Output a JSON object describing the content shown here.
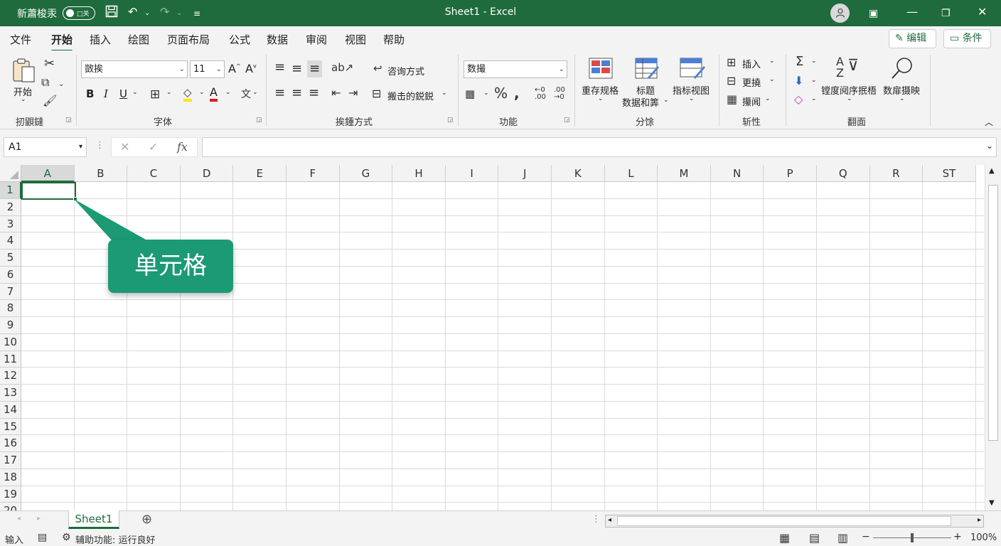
{
  "titlebar": {
    "autosave_label": "新蕭梭汞",
    "toggle_text": "□关",
    "window_title": "Sheet1  -  Excel"
  },
  "menu": {
    "tabs": [
      "文件",
      "开始",
      "插入",
      "绘图",
      "页面布局",
      "公式",
      "数据",
      "审阅",
      "视图",
      "帮助"
    ],
    "edit_button": "编辑",
    "comment_button": "条件"
  },
  "ribbon": {
    "clipboard": {
      "paste_label": "开始",
      "group_name": "扨鼰鐽"
    },
    "font": {
      "font_name": "敳挨",
      "font_size": "11",
      "group_name": "字体"
    },
    "alignment": {
      "wrap_label": "咨询方式",
      "merge_label": "搬击的鋭鋭",
      "group_name": "挨鍾方式"
    },
    "number": {
      "format": "数撮",
      "group_name": "功能"
    },
    "styles": {
      "cond_label": "重存规格",
      "table_label_1": "标题",
      "table_label_2": "数据和筭",
      "cell_label": "指标视图",
      "group_name": "分馀"
    },
    "cells": {
      "insert": "插入",
      "delete": "更撓",
      "format": "攥闻",
      "group_name": "斩性"
    },
    "editing": {
      "sort_label": "镗度阋序抿梧",
      "find_label": "数扉摄映",
      "group_name": "翻面"
    }
  },
  "formula_bar": {
    "name_box": "A1",
    "fx_label": "fx",
    "formula": ""
  },
  "grid": {
    "columns": [
      "A",
      "B",
      "C",
      "D",
      "E",
      "F",
      "G",
      "H",
      "I",
      "J",
      "K",
      "L",
      "M",
      "N",
      "P",
      "Q",
      "R",
      "ST"
    ],
    "rows": [
      "1",
      "2",
      "3",
      "4",
      "5",
      "6",
      "7",
      "8",
      "9",
      "10",
      "11",
      "12",
      "13",
      "14",
      "15",
      "16",
      "17",
      "18",
      "19",
      "20"
    ],
    "active_cell": "A1"
  },
  "callout": {
    "text": "单元格"
  },
  "sheets": {
    "tabs": [
      "Sheet1"
    ]
  },
  "status": {
    "mode": "输入",
    "accessibility": "辅助功能: 运行良好",
    "zoom": "100%"
  },
  "colors": {
    "accent": "#1f6b3d",
    "callout": "#1b9a73"
  }
}
